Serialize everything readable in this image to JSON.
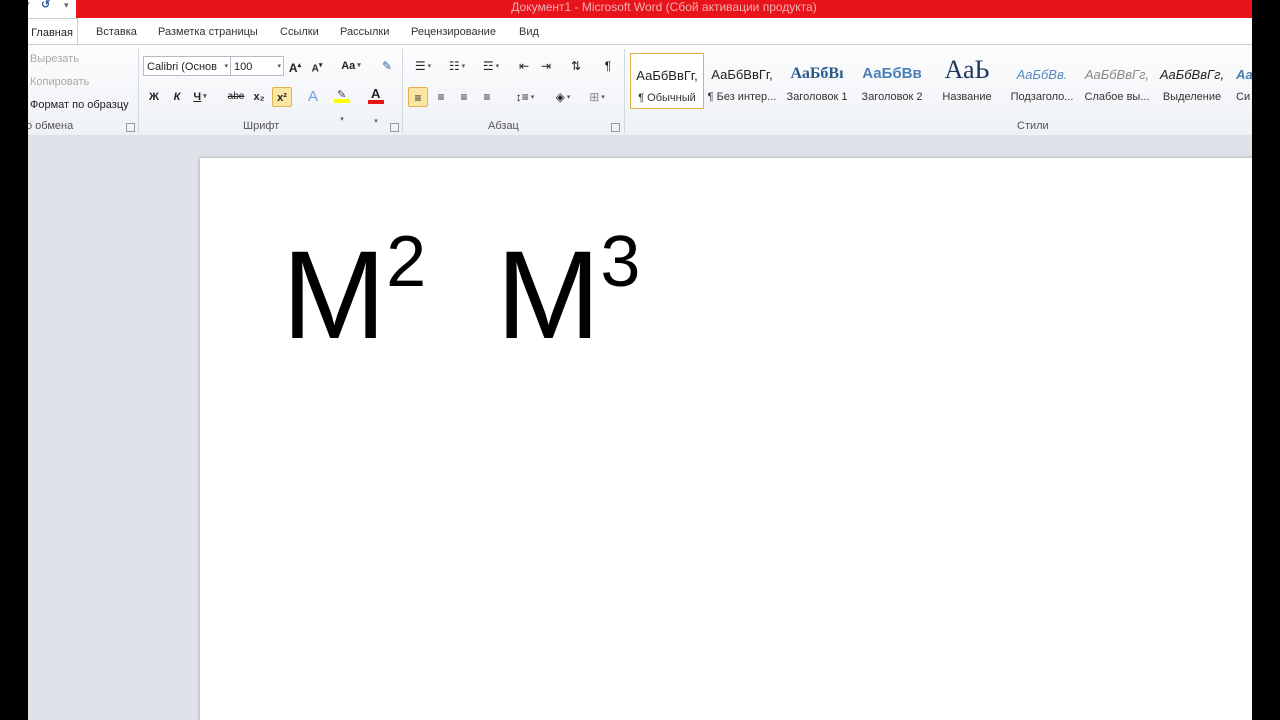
{
  "window": {
    "title": "Документ1 - Microsoft Word (Сбой активации продукта)"
  },
  "qat": {
    "undo_icon": "undo-icon",
    "customize_icon": "dropdown-arrow-icon"
  },
  "tabs": [
    "Главная",
    "Вставка",
    "Разметка страницы",
    "Ссылки",
    "Рассылки",
    "Рецензирование",
    "Вид"
  ],
  "clipboard": {
    "items": [
      "Вырезать",
      "Копировать",
      "Формат по образцу"
    ],
    "label": "о обмена"
  },
  "font": {
    "name": "Calibri (Основ",
    "size": "100",
    "label": "Шрифт",
    "bold": "Ж",
    "italic": "К",
    "underline": "Ч",
    "strike": "abe",
    "subscript": "x₂",
    "superscript": "x²",
    "grow": "A",
    "shrink": "A",
    "change_case": "Aa",
    "color_letter": "A",
    "highlight_color": "#ffff00",
    "font_color": "#e81414",
    "superscript_active": true
  },
  "paragraph": {
    "label": "Абзац",
    "pilcrow": "¶"
  },
  "styles": {
    "label": "Стили",
    "items": [
      {
        "sample": "АаБбВвГг,",
        "name": "¶ Обычный"
      },
      {
        "sample": "АаБбВвГг,",
        "name": "¶ Без интер..."
      },
      {
        "sample": "АаБбВı",
        "name": "Заголовок 1"
      },
      {
        "sample": "АаБбВв",
        "name": "Заголовок 2"
      },
      {
        "sample": "АаЬ",
        "name": "Название"
      },
      {
        "sample": "АаБбВв.",
        "name": "Подзаголо..."
      },
      {
        "sample": "АаБбВвГг,",
        "name": "Слабое вы..."
      },
      {
        "sample": "АаБбВвГг,",
        "name": "Выделение"
      },
      {
        "sample": "Аа",
        "name": "Си"
      }
    ]
  },
  "document": {
    "text1": "M",
    "sup1": "2",
    "text2": "M",
    "sup2": "3"
  }
}
